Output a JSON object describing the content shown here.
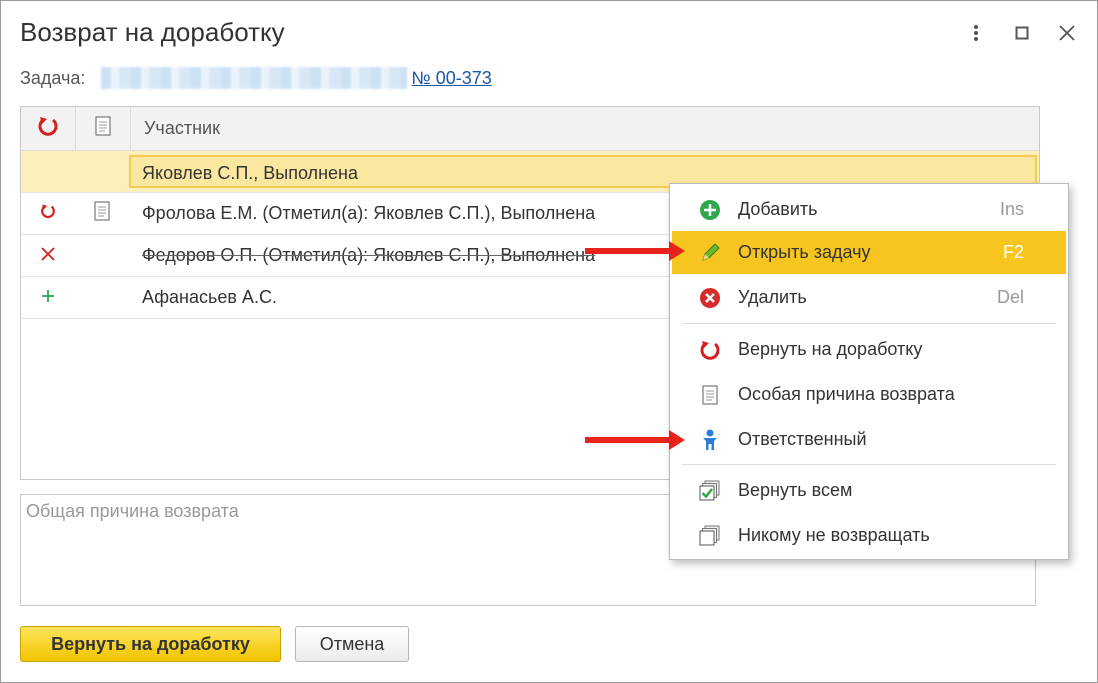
{
  "window": {
    "title": "Возврат на доработку"
  },
  "task": {
    "label": "Задача:",
    "link": "№ 00-373"
  },
  "table": {
    "columns": {
      "participant": "Участник"
    },
    "rows": [
      {
        "text": "Яковлев С.П., Выполнена",
        "icon1": "",
        "icon2": "",
        "selected": true
      },
      {
        "text": "Фролова Е.М. (Отметил(а): Яковлев С.П.), Выполнена",
        "icon1": "return-icon",
        "icon2": "document-icon"
      },
      {
        "text": "Федоров О.П. (Отметил(а): Яковлев С.П.), Выполнена",
        "icon1": "cross-icon",
        "icon2": "",
        "struck": true
      },
      {
        "text": "Афанасьев А.С.",
        "icon1": "plus-icon",
        "icon2": ""
      }
    ]
  },
  "reason": {
    "placeholder": "Общая причина возврата"
  },
  "buttons": {
    "return": "Вернуть на доработку",
    "cancel": "Отмена"
  },
  "context_menu": {
    "items": [
      {
        "label": "Добавить",
        "shortcut": "Ins",
        "icon": "add-circle-icon"
      },
      {
        "label": "Открыть задачу",
        "shortcut": "F2",
        "icon": "pencil-icon",
        "highlighted": true
      },
      {
        "label": "Удалить",
        "shortcut": "Del",
        "icon": "delete-circle-icon"
      },
      {
        "label": "Вернуть на доработку",
        "shortcut": "",
        "icon": "return-icon"
      },
      {
        "label": "Особая причина возврата",
        "shortcut": "",
        "icon": "document-icon"
      },
      {
        "label": "Ответственный",
        "shortcut": "",
        "icon": "person-icon"
      },
      {
        "label": "Вернуть всем",
        "shortcut": "",
        "icon": "check-all-icon"
      },
      {
        "label": "Никому не возвращать",
        "shortcut": "",
        "icon": "uncheck-all-icon"
      }
    ]
  },
  "colors": {
    "accent": "#f6c51f",
    "link": "#1a56a6",
    "arrow": "#e8231b",
    "return_icon": "#d32020",
    "add_icon": "#2ea84a"
  }
}
